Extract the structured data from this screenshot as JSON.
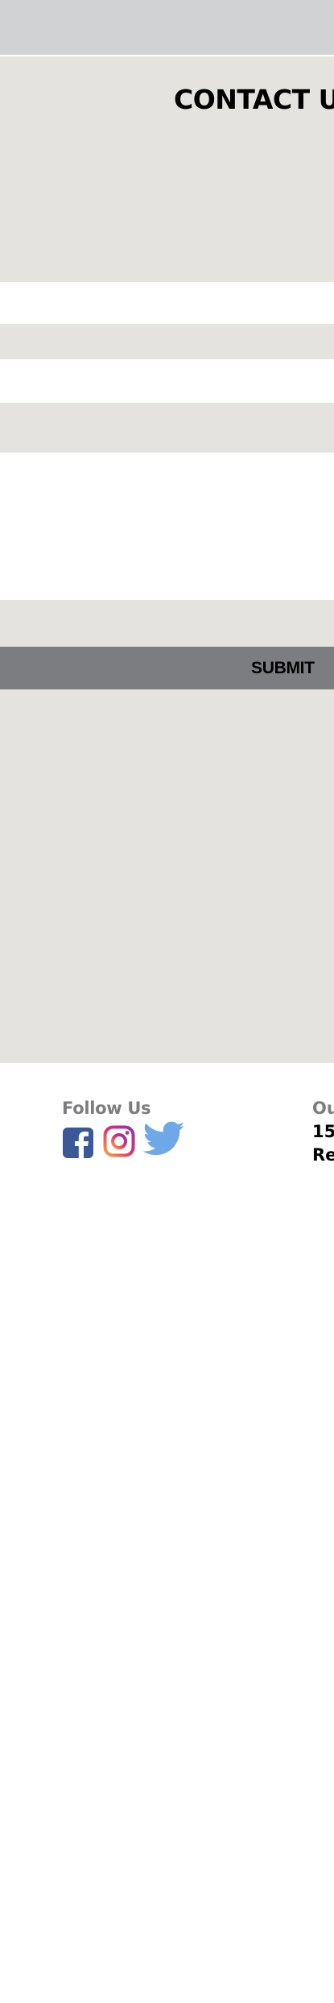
{
  "contact": {
    "title": "CONTACT US"
  },
  "form": {
    "submit_label": "SUBMIT"
  },
  "footer": {
    "follow_heading": "Follow Us",
    "office_heading": "Ou",
    "address_line_1": "15",
    "address_line_2": "Re"
  },
  "social": [
    {
      "name": "facebook-icon",
      "color": "#3b5998"
    },
    {
      "name": "instagram-icon",
      "colors": [
        "#f9a23b",
        "#e1306c",
        "#833ab4"
      ]
    },
    {
      "name": "twitter-icon",
      "color": "#6ea8e6"
    }
  ],
  "colors": {
    "top_bar": "#d1d2d4",
    "section_gray": "#e4e3e0",
    "submit_bar": "#7c7d80",
    "heading_gray": "#7c7d80"
  }
}
